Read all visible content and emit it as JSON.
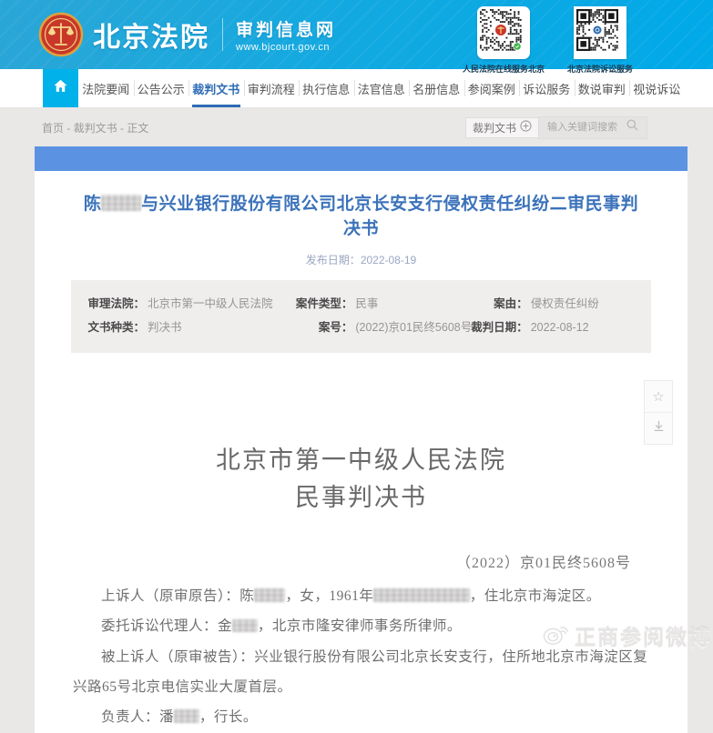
{
  "header": {
    "site_name": "北京法院",
    "site_subtitle": "审判信息网",
    "site_url": "www.bjcourt.gov.cn",
    "qr_codes": [
      {
        "label": "人民法院在线服务北京",
        "style": "rounded-red-emblem"
      },
      {
        "label": "北京法院诉讼服务",
        "style": "square-blue-emblem"
      }
    ]
  },
  "nav": {
    "items": [
      {
        "label": "法院要闻",
        "active": false
      },
      {
        "label": "公告公示",
        "active": false
      },
      {
        "label": "裁判文书",
        "active": true
      },
      {
        "label": "审判流程",
        "active": false
      },
      {
        "label": "执行信息",
        "active": false
      },
      {
        "label": "法官信息",
        "active": false
      },
      {
        "label": "名册信息",
        "active": false
      },
      {
        "label": "参阅案例",
        "active": false
      },
      {
        "label": "诉讼服务",
        "active": false
      },
      {
        "label": "数说审判",
        "active": false
      },
      {
        "label": "视说诉讼",
        "active": false
      }
    ]
  },
  "breadcrumb": {
    "text": "首页 - 裁判文书 - 正文"
  },
  "search": {
    "category": "裁判文书",
    "placeholder": "输入关键词搜索"
  },
  "article": {
    "title_segments": [
      {
        "t": "陈"
      },
      {
        "r": 2.3
      },
      {
        "t": "与兴业银行股份有限公司北京长安支行侵权责任纠纷二审民事判决书"
      }
    ],
    "publish_label": "发布日期：",
    "publish_date": "2022-08-19",
    "meta": {
      "rows": [
        [
          {
            "label": "审理法院：",
            "value": "北京市第一中级人民法院"
          },
          {
            "label": "案件类型：",
            "value": "民事"
          },
          {
            "label": "案由：",
            "value": "侵权责任纠纷"
          }
        ],
        [
          {
            "label": "文书种类：",
            "value": "判决书"
          },
          {
            "label": "案号：",
            "value": "(2022)京01民终5608号"
          },
          {
            "label": "裁判日期：",
            "value": "2022-08-12"
          }
        ]
      ]
    }
  },
  "document": {
    "court": "北京市第一中级人民法院",
    "doc_type": "民事判决书",
    "case_no": "（2022）京01民终5608号",
    "paragraphs": [
      [
        {
          "t": "上诉人（原审原告）：陈"
        },
        {
          "r": 2.2
        },
        {
          "t": "，女，1961年"
        },
        {
          "r": 6.8
        },
        {
          "t": "，住北京市海淀区。"
        }
      ],
      [
        {
          "t": "委托诉讼代理人：金"
        },
        {
          "r": 1.8
        },
        {
          "t": "，北京市隆安律师事务所律师。"
        }
      ],
      [
        {
          "t": "被上诉人（原审被告）：兴业银行股份有限公司北京长安支行，住所地北京市海淀区复兴路65号北京电信实业大厦首层。"
        }
      ],
      [
        {
          "t": "负责人：潘"
        },
        {
          "r": 1.8
        },
        {
          "t": "，行长。"
        }
      ]
    ]
  },
  "side_toolbar": {
    "items": [
      {
        "icon": "star-icon",
        "glyph": "☆"
      },
      {
        "icon": "download-icon",
        "glyph": "⤓"
      }
    ]
  },
  "watermark": {
    "text": "正商参阅微博",
    "icon": "weibo-icon"
  },
  "colors": {
    "header_gradient_start": "#2ba6d6",
    "header_gradient_end": "#00a9e8",
    "home_tab": "#00b1ea",
    "nav_active": "#2e6cb5",
    "banner_blue": "#5b93e2",
    "title_blue": "#3b72ba",
    "meta_bg": "#f0eded",
    "page_bg": "#eae7e7"
  }
}
